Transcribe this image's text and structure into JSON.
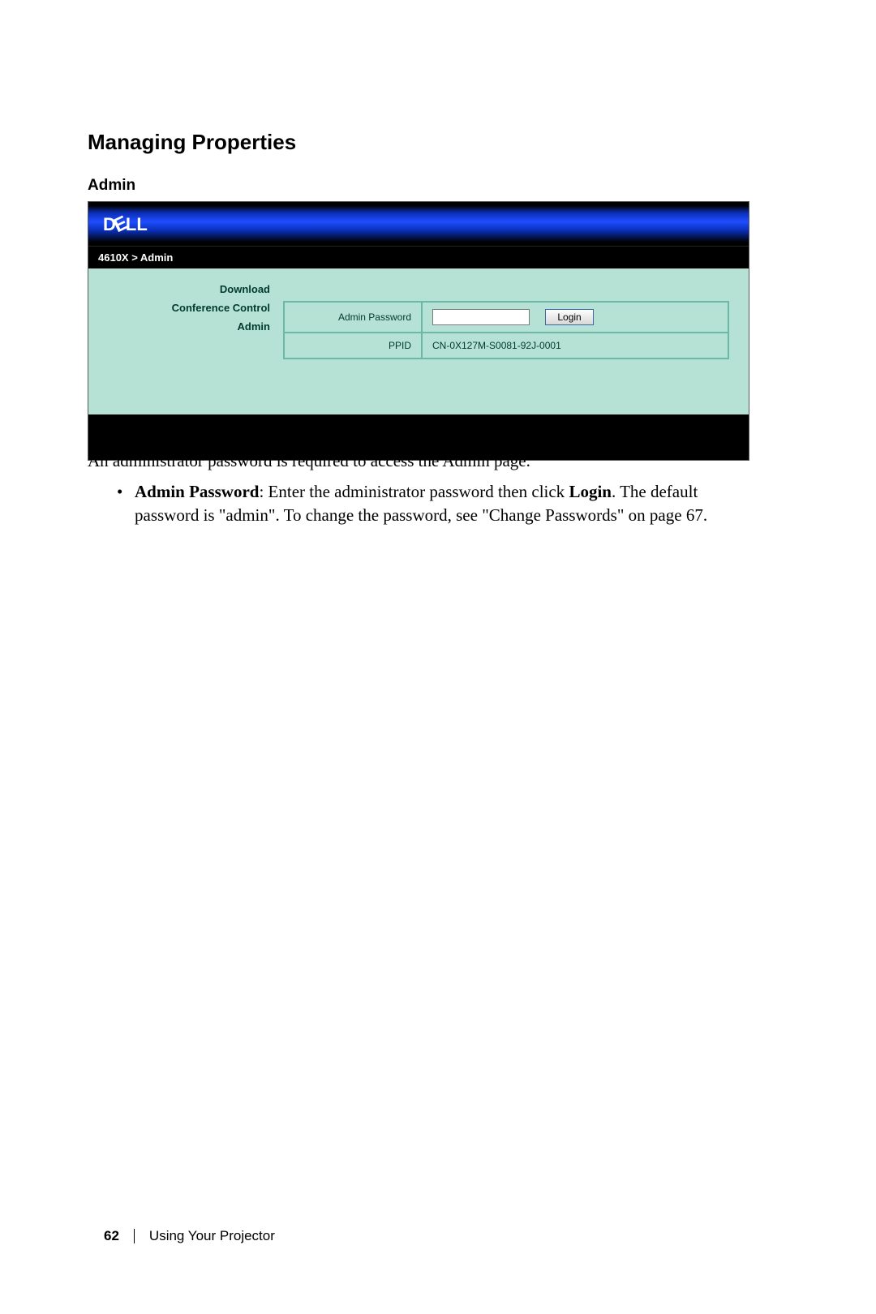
{
  "page": {
    "heading": "Managing Properties",
    "subheading": "Admin"
  },
  "screenshot": {
    "logo_text": "D",
    "logo_e": "E",
    "logo_rest": "LL",
    "breadcrumb": "4610X > Admin",
    "sidebar": {
      "items": [
        {
          "label": "Download"
        },
        {
          "label": "Conference Control"
        },
        {
          "label": "Admin"
        }
      ]
    },
    "form": {
      "password_label": "Admin Password",
      "login_label": "Login",
      "ppid_label": "PPID",
      "ppid_value": "CN-0X127M-S0081-92J-0001"
    }
  },
  "body": {
    "intro": "An administrator password is required to access the Admin page.",
    "bullet_bold": "Admin Password",
    "bullet_text_1": ": Enter the administrator password then click ",
    "bullet_bold2": "Login",
    "bullet_text_2": ". The default password is \"admin\". To change the password, see \"Change Passwords\" on page 67."
  },
  "footer": {
    "page_number": "62",
    "section": "Using Your Projector"
  }
}
